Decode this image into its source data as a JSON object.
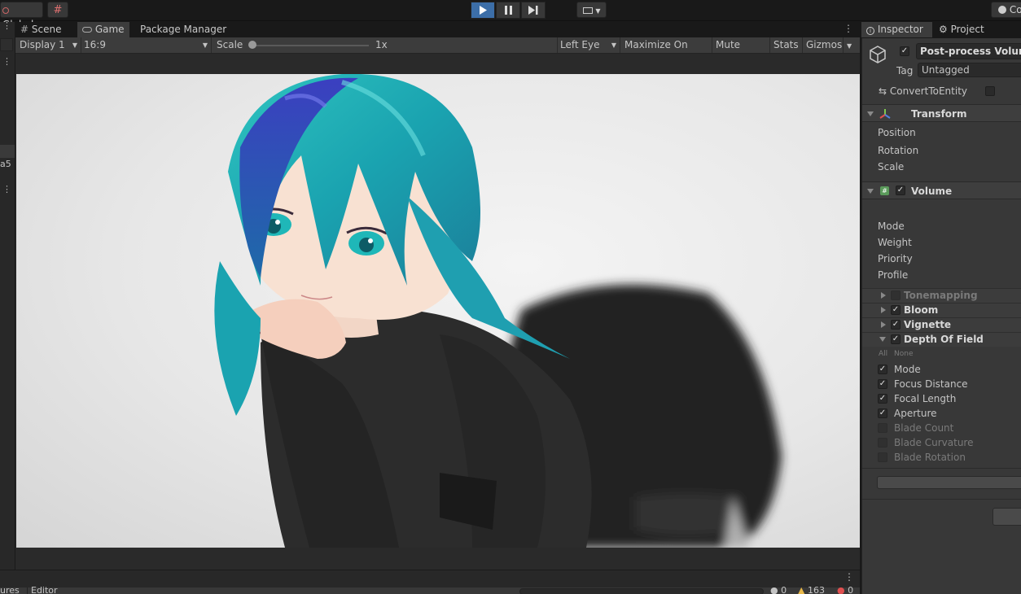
{
  "toolbar": {
    "global_label": "Global",
    "right_label": "Co"
  },
  "game_tabs": [
    {
      "label": "Scene"
    },
    {
      "label": "Game"
    },
    {
      "label": "Package Manager"
    }
  ],
  "game_bar": {
    "display": "Display 1",
    "aspect": "16:9",
    "scale_label": "Scale",
    "scale_value": "1x",
    "eye": "Left Eye",
    "maximize": "Maximize On Play",
    "mute": "Mute Audio",
    "stats": "Stats",
    "gizmos": "Gizmos"
  },
  "left_strip": {
    "text": "a5"
  },
  "bottom_bar": {
    "left_text": "ures",
    "editor_label": "Editor",
    "count_warnings": "163",
    "count_info": "0",
    "count_errors": "0"
  },
  "inspector_tabs": [
    {
      "label": "Inspector"
    },
    {
      "label": "Project Setting"
    }
  ],
  "inspector": {
    "object_name": "Post-process Volume",
    "tag_label": "Tag",
    "tag_value": "Untagged",
    "convert_label": "ConvertToEntity",
    "transform": {
      "title": "Transform",
      "fields": [
        "Position",
        "Rotation",
        "Scale"
      ]
    },
    "volume": {
      "title": "Volume",
      "fields": [
        "Mode",
        "Weight",
        "Priority",
        "Profile"
      ]
    },
    "overrides": [
      {
        "label": "Tonemapping",
        "checked": false,
        "enabled": false
      },
      {
        "label": "Bloom",
        "checked": true,
        "enabled": true
      },
      {
        "label": "Vignette",
        "checked": true,
        "enabled": true
      },
      {
        "label": "Depth Of Field",
        "checked": true,
        "enabled": true
      }
    ],
    "all_label": "All",
    "none_label": "None",
    "dof_params": [
      {
        "label": "Mode",
        "checked": true,
        "enabled": true
      },
      {
        "label": "Focus Distance",
        "checked": true,
        "enabled": true
      },
      {
        "label": "Focal Length",
        "checked": true,
        "enabled": true
      },
      {
        "label": "Aperture",
        "checked": true,
        "enabled": true
      },
      {
        "label": "Blade Count",
        "checked": false,
        "enabled": false
      },
      {
        "label": "Blade Curvature",
        "checked": false,
        "enabled": false
      },
      {
        "label": "Blade Rotation",
        "checked": false,
        "enabled": false
      }
    ]
  }
}
